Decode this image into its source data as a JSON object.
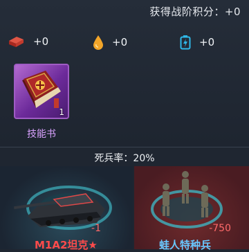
{
  "header": {
    "score_text": "获得战阶积分：+0"
  },
  "resources": [
    {
      "icon": "brick-icon",
      "value": "+0",
      "color": "#c0392b"
    },
    {
      "icon": "oil-drop-icon",
      "value": "+0",
      "color": "#f0a020"
    },
    {
      "icon": "battery-icon",
      "value": "+0",
      "color": "#2fb8e8"
    }
  ],
  "reward_item": {
    "icon": "skill-book-icon",
    "count": "1",
    "label": "技能书"
  },
  "death_rate_text": "死兵率：20%",
  "units": [
    {
      "icon": "tank-icon",
      "delta": "-1",
      "name": "M1A2坦克★",
      "name_color": "#ff4b4b"
    },
    {
      "icon": "soldier-squad-icon",
      "delta": "-750",
      "name": "蛙人特种兵",
      "name_color": "#69c8ff"
    }
  ]
}
